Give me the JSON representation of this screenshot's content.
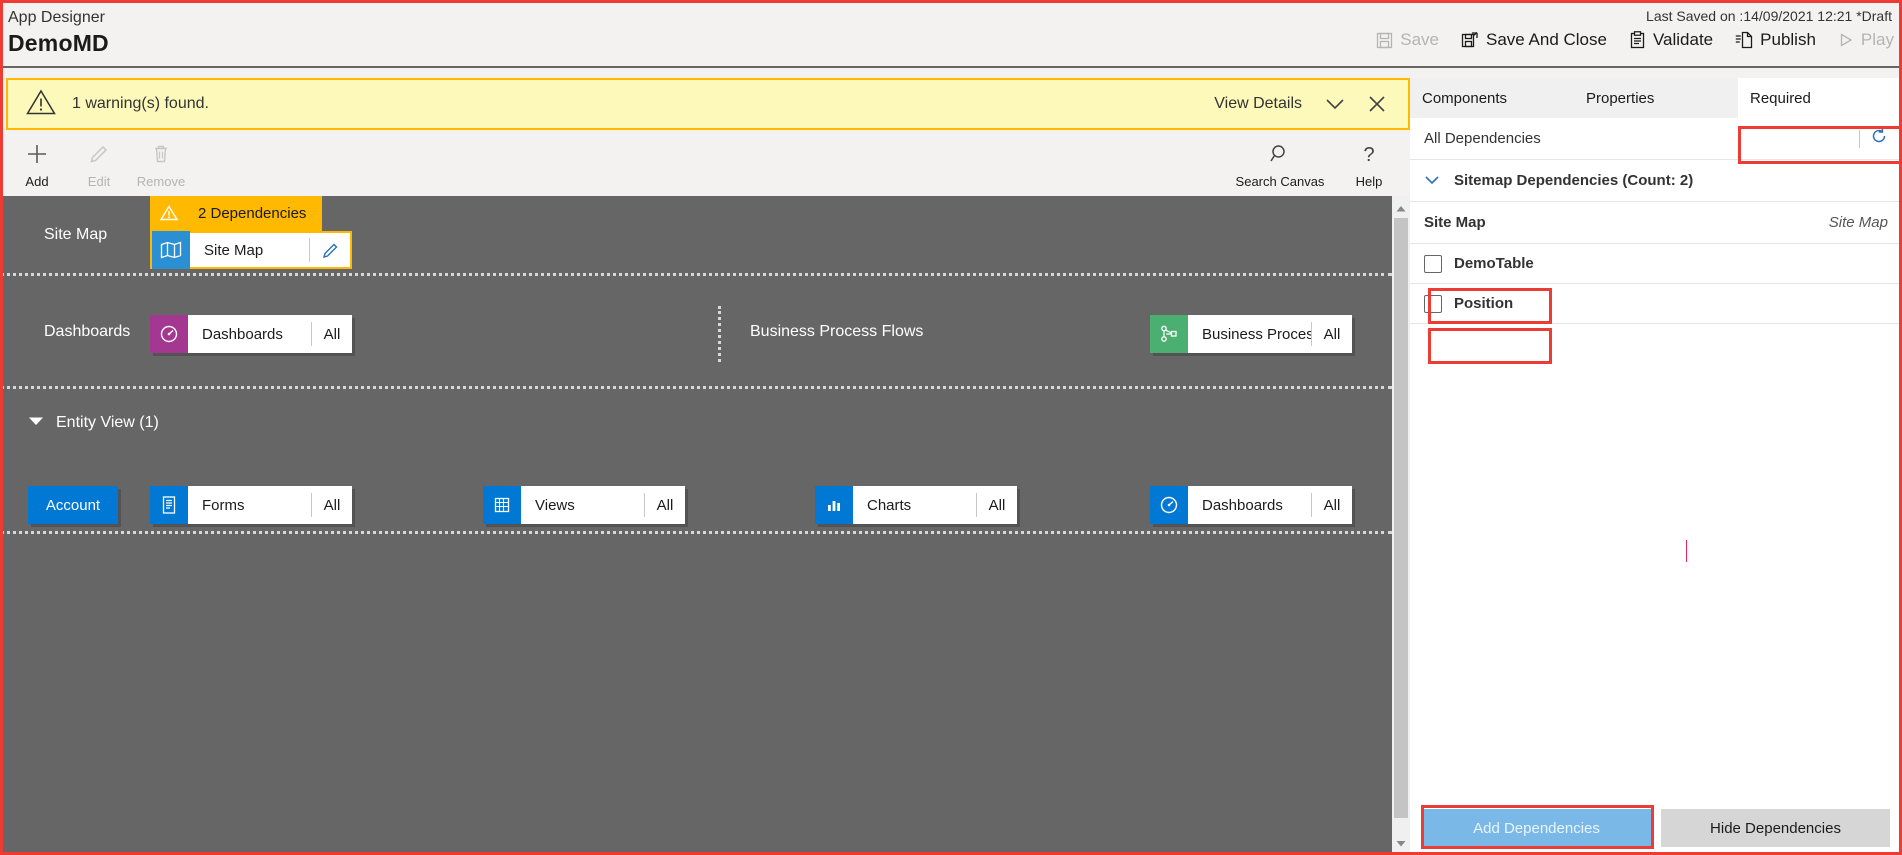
{
  "header": {
    "app_label": "App Designer",
    "title": "DemoMD",
    "last_saved": "Last Saved on :14/09/2021 12:21 *Draft",
    "commands": [
      {
        "label": "Save",
        "icon": "save-icon",
        "disabled": true
      },
      {
        "label": "Save And Close",
        "icon": "save-and-close-icon",
        "disabled": false
      },
      {
        "label": "Validate",
        "icon": "validate-icon",
        "disabled": false
      },
      {
        "label": "Publish",
        "icon": "publish-icon",
        "disabled": false
      },
      {
        "label": "Play",
        "icon": "play-icon",
        "disabled": true
      }
    ]
  },
  "warning_bar": {
    "icon": "warning-triangle-icon",
    "message": "1 warning(s) found.",
    "view_details_label": "View Details",
    "chevron_icon": "chevron-down-icon",
    "close_icon": "close-icon",
    "background": "#fcf9ba",
    "border": "#ffb900"
  },
  "ribbon": {
    "left_buttons": [
      {
        "label": "Add",
        "icon": "plus-icon",
        "disabled": false
      },
      {
        "label": "Edit",
        "icon": "pencil-icon",
        "disabled": true
      },
      {
        "label": "Remove",
        "icon": "trash-icon",
        "disabled": true
      }
    ],
    "right_buttons": [
      {
        "label": "Search Canvas",
        "icon": "search-icon",
        "disabled": false
      },
      {
        "label": "Help",
        "icon": "question-mark-icon",
        "disabled": false
      }
    ]
  },
  "canvas": {
    "sitemap_row": {
      "label": "Site Map",
      "dependency_banner": "2 Dependencies",
      "dependency_icon": "warning-triangle-icon",
      "tile": {
        "name": "Site Map",
        "icon": "map-icon",
        "icon_color": "#2b8fd4",
        "edit_icon": "pencil-icon"
      }
    },
    "dashboards_row": {
      "label": "Dashboards",
      "tile": {
        "name": "Dashboards",
        "count": "All",
        "icon": "gauge-icon",
        "icon_color": "#a4378f"
      }
    },
    "bpf_row": {
      "label": "Business Process Flows",
      "tile": {
        "name": "Business Proces...",
        "count": "All",
        "icon": "process-flow-icon",
        "icon_color": "#4caf72"
      }
    },
    "entity_view": {
      "section_label": "Entity View (1)",
      "collapse_icon": "caret-down-icon",
      "entity_button": "Account",
      "tiles": [
        {
          "name": "Forms",
          "count": "All",
          "icon": "form-icon",
          "icon_color": "#0078d4"
        },
        {
          "name": "Views",
          "count": "All",
          "icon": "grid-icon",
          "icon_color": "#0078d4"
        },
        {
          "name": "Charts",
          "count": "All",
          "icon": "bar-chart-icon",
          "icon_color": "#0078d4"
        },
        {
          "name": "Dashboards",
          "count": "All",
          "icon": "gauge-icon",
          "icon_color": "#0078d4"
        }
      ]
    },
    "scrollbar": {
      "up_icon": "scroll-up-icon",
      "down_icon": "scroll-down-icon"
    }
  },
  "panel": {
    "tabs": [
      {
        "label": "Components",
        "active": false
      },
      {
        "label": "Properties",
        "active": false
      },
      {
        "label": "Required",
        "active": true
      }
    ],
    "all_dependencies_label": "All Dependencies",
    "refresh_icon": "refresh-icon",
    "group": {
      "label": "Sitemap Dependencies (Count: 2)",
      "chevron_icon": "chevron-down-icon"
    },
    "list_header": {
      "name": "Site Map",
      "type": "Site Map"
    },
    "rows": [
      {
        "name": "DemoTable",
        "checked": false
      },
      {
        "name": "Position",
        "checked": false
      }
    ],
    "footer": {
      "add_label": "Add Dependencies",
      "add_disabled": true,
      "hide_label": "Hide Dependencies"
    }
  },
  "annotations": {
    "color": "#ee3b33",
    "boxes": [
      "required-tab",
      "demotable-row",
      "position-row",
      "add-dependencies-button",
      "screenshot-border"
    ]
  }
}
